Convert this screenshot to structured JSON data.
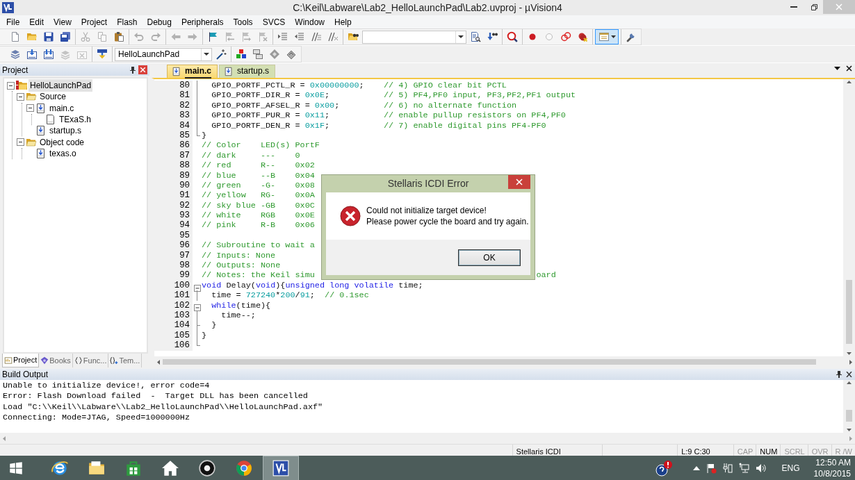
{
  "window": {
    "title": "C:\\Keil\\Labware\\Lab2_HelloLaunchPad\\Lab2.uvproj - µVision4"
  },
  "menu": [
    "File",
    "Edit",
    "View",
    "Project",
    "Flash",
    "Debug",
    "Peripherals",
    "Tools",
    "SVCS",
    "Window",
    "Help"
  ],
  "toolbar_1": [
    {
      "buttons": [
        {
          "kind": "new",
          "disabled": false,
          "pressed": false
        },
        {
          "kind": "open",
          "disabled": false,
          "pressed": false
        },
        {
          "kind": "save",
          "disabled": false,
          "pressed": false
        },
        {
          "kind": "save-all",
          "disabled": false,
          "pressed": false
        }
      ]
    },
    {
      "buttons": [
        {
          "kind": "cut",
          "disabled": true,
          "pressed": false
        },
        {
          "kind": "copy",
          "disabled": true,
          "pressed": false
        },
        {
          "kind": "paste",
          "disabled": false,
          "pressed": false
        }
      ]
    },
    {
      "buttons": [
        {
          "kind": "undo",
          "disabled": true,
          "pressed": false
        },
        {
          "kind": "redo",
          "disabled": true,
          "pressed": false
        }
      ]
    },
    {
      "buttons": [
        {
          "kind": "back",
          "disabled": true,
          "pressed": false
        },
        {
          "kind": "forward",
          "disabled": true,
          "pressed": false
        }
      ]
    },
    {
      "buttons": [
        {
          "kind": "bookmark",
          "disabled": false,
          "pressed": false
        },
        {
          "kind": "bookmark-prev",
          "disabled": true,
          "pressed": false
        },
        {
          "kind": "bookmark-next",
          "disabled": true,
          "pressed": false
        },
        {
          "kind": "bookmark-clear",
          "disabled": true,
          "pressed": false
        }
      ]
    },
    {
      "buttons": [
        {
          "kind": "indent",
          "disabled": false,
          "pressed": false
        },
        {
          "kind": "unindent",
          "disabled": false,
          "pressed": false
        },
        {
          "kind": "comment",
          "disabled": false,
          "pressed": false
        },
        {
          "kind": "uncomment",
          "disabled": false,
          "pressed": false
        }
      ]
    },
    {
      "buttons": [
        {
          "kind": "find-in-files",
          "disabled": false,
          "pressed": false
        },
        {
          "kind": "combo"
        },
        {
          "kind": "find",
          "disabled": false,
          "pressed": false
        },
        {
          "kind": "incremental-find",
          "disabled": false,
          "pressed": false
        }
      ]
    },
    {
      "buttons": [
        {
          "kind": "debug",
          "disabled": false,
          "pressed": false
        }
      ]
    },
    {
      "buttons": [
        {
          "kind": "breakpoint",
          "disabled": false,
          "pressed": false
        },
        {
          "kind": "breakpoint-enable",
          "disabled": true,
          "pressed": false
        },
        {
          "kind": "breakpoint-disable",
          "disabled": false,
          "pressed": false
        },
        {
          "kind": "breakpoint-kill",
          "disabled": false,
          "pressed": false
        }
      ]
    },
    {
      "buttons": [
        {
          "kind": "window",
          "disabled": false,
          "pressed": true
        }
      ]
    },
    {
      "buttons": [
        {
          "kind": "configure",
          "disabled": false,
          "pressed": false
        }
      ]
    }
  ],
  "toolbar_2": [
    {
      "buttons": [
        {
          "kind": "translate",
          "disabled": false,
          "pressed": false
        },
        {
          "kind": "build",
          "disabled": false,
          "pressed": false
        },
        {
          "kind": "rebuild",
          "disabled": false,
          "pressed": false
        },
        {
          "kind": "batch",
          "disabled": true,
          "pressed": false
        },
        {
          "kind": "stop",
          "disabled": true,
          "pressed": false
        }
      ]
    },
    {
      "buttons": [
        {
          "kind": "download",
          "disabled": false,
          "pressed": false
        }
      ]
    },
    {
      "buttons": [
        {
          "kind": "combo",
          "value": "HelloLaunchPad"
        },
        {
          "kind": "options",
          "disabled": false,
          "pressed": false
        }
      ]
    },
    {
      "buttons": [
        {
          "kind": "components",
          "disabled": false,
          "pressed": false
        },
        {
          "kind": "environment",
          "disabled": false,
          "pressed": false
        },
        {
          "kind": "books",
          "disabled": false,
          "pressed": false
        },
        {
          "kind": "packs",
          "disabled": false,
          "pressed": false
        }
      ]
    }
  ],
  "project_pane": {
    "title": "Project",
    "tree": [
      {
        "label": "HelloLaunchPad",
        "kind": "project",
        "expanded": true,
        "selected": true,
        "children": [
          {
            "label": "Source",
            "kind": "group",
            "expanded": true,
            "selected": false,
            "children": [
              {
                "label": "main.c",
                "kind": "source",
                "expanded": true,
                "selected": false,
                "children": [
                  {
                    "label": "TExaS.h",
                    "kind": "header",
                    "selected": false
                  }
                ]
              },
              {
                "label": "startup.s",
                "kind": "source",
                "selected": false
              }
            ]
          },
          {
            "label": "Object code",
            "kind": "group",
            "expanded": true,
            "selected": false,
            "children": [
              {
                "label": "texas.o",
                "kind": "source",
                "selected": false
              }
            ]
          }
        ]
      }
    ],
    "tabs": [
      {
        "label": "Project",
        "kind": "project",
        "selected": true
      },
      {
        "label": "Books",
        "kind": "books",
        "selected": false
      },
      {
        "label": "Func...",
        "kind": "functions",
        "selected": false
      },
      {
        "label": "Tem...",
        "kind": "templates",
        "selected": false
      }
    ]
  },
  "editor": {
    "tabs": [
      {
        "label": "main.c",
        "selected": true
      },
      {
        "label": "startup.s",
        "selected": false
      }
    ],
    "lines": [
      {
        "number": "80",
        "kind": "line",
        "segments": [
          {
            "kind": "plain",
            "text": "  GPIO_PORTF_PCTL_R = "
          },
          {
            "kind": "number",
            "text": "0x00000000"
          },
          {
            "kind": "plain",
            "text": ";    "
          },
          {
            "kind": "comment",
            "text": "// 4) GPIO clear bit PCTL"
          }
        ]
      },
      {
        "number": "81",
        "kind": "line",
        "segments": [
          {
            "kind": "plain",
            "text": "  GPIO_PORTF_DIR_R = "
          },
          {
            "kind": "number",
            "text": "0x0E"
          },
          {
            "kind": "plain",
            "text": ";           "
          },
          {
            "kind": "comment",
            "text": "// 5) PF4,PF0 input, PF3,PF2,PF1 output"
          }
        ]
      },
      {
        "number": "82",
        "kind": "line",
        "segments": [
          {
            "kind": "plain",
            "text": "  GPIO_PORTF_AFSEL_R = "
          },
          {
            "kind": "number",
            "text": "0x00"
          },
          {
            "kind": "plain",
            "text": ";         "
          },
          {
            "kind": "comment",
            "text": "// 6) no alternate function"
          }
        ]
      },
      {
        "number": "83",
        "kind": "line",
        "segments": [
          {
            "kind": "plain",
            "text": "  GPIO_PORTF_PUR_R = "
          },
          {
            "kind": "number",
            "text": "0x11"
          },
          {
            "kind": "plain",
            "text": ";           "
          },
          {
            "kind": "comment",
            "text": "// enable pullup resistors on PF4,PF0"
          }
        ]
      },
      {
        "number": "84",
        "kind": "line",
        "segments": [
          {
            "kind": "plain",
            "text": "  GPIO_PORTF_DEN_R = "
          },
          {
            "kind": "number",
            "text": "0x1F"
          },
          {
            "kind": "plain",
            "text": ";           "
          },
          {
            "kind": "comment",
            "text": "// 7) enable digital pins PF4-PF0"
          }
        ]
      },
      {
        "number": "85",
        "kind": "end",
        "segments": [
          {
            "kind": "plain",
            "text": "}"
          }
        ]
      },
      {
        "number": "86",
        "segments": [
          {
            "kind": "comment",
            "text": "// Color    LED(s) PortF"
          }
        ]
      },
      {
        "number": "87",
        "segments": [
          {
            "kind": "comment",
            "text": "// dark     ---    0"
          }
        ]
      },
      {
        "number": "88",
        "segments": [
          {
            "kind": "comment",
            "text": "// red      R--    0x02"
          }
        ]
      },
      {
        "number": "89",
        "segments": [
          {
            "kind": "comment",
            "text": "// blue     --B    0x04"
          }
        ]
      },
      {
        "number": "90",
        "segments": [
          {
            "kind": "comment",
            "text": "// green    -G-    0x08"
          }
        ]
      },
      {
        "number": "91",
        "segments": [
          {
            "kind": "comment",
            "text": "// yellow   RG-    0x0A"
          }
        ]
      },
      {
        "number": "92",
        "segments": [
          {
            "kind": "comment",
            "text": "// sky blue -GB    0x0C"
          }
        ]
      },
      {
        "number": "93",
        "segments": [
          {
            "kind": "comment",
            "text": "// white    RGB    0x0E"
          }
        ]
      },
      {
        "number": "94",
        "segments": [
          {
            "kind": "comment",
            "text": "// pink     R-B    0x06"
          }
        ]
      },
      {
        "number": "95"
      },
      {
        "number": "96",
        "segments": [
          {
            "kind": "comment",
            "text": "// Subroutine to wait a"
          }
        ]
      },
      {
        "number": "97",
        "segments": [
          {
            "kind": "comment",
            "text": "// Inputs: None"
          }
        ]
      },
      {
        "number": "98",
        "segments": [
          {
            "kind": "comment",
            "text": "// Outputs: None"
          }
        ]
      },
      {
        "number": "99",
        "segments": [
          {
            "kind": "comment",
            "text": "// Notes: the Keil simu"
          },
          {
            "kind": "comment",
            "text": "                                             oard"
          }
        ]
      },
      {
        "number": "100",
        "kind": "open",
        "segments": [
          {
            "kind": "keyword",
            "text": "void"
          },
          {
            "kind": "plain",
            "text": " Delay("
          },
          {
            "kind": "keyword",
            "text": "void"
          },
          {
            "kind": "plain",
            "text": "){"
          },
          {
            "kind": "keyword",
            "text": "unsigned long volatile"
          },
          {
            "kind": "plain",
            "text": " time;"
          }
        ]
      },
      {
        "number": "101",
        "kind": "line",
        "segments": [
          {
            "kind": "plain",
            "text": "  time = "
          },
          {
            "kind": "number",
            "text": "727240"
          },
          {
            "kind": "plain",
            "text": "*"
          },
          {
            "kind": "number",
            "text": "200"
          },
          {
            "kind": "plain",
            "text": "/"
          },
          {
            "kind": "number",
            "text": "91"
          },
          {
            "kind": "plain",
            "text": ";  "
          },
          {
            "kind": "comment",
            "text": "// 0.1sec"
          }
        ]
      },
      {
        "number": "102",
        "kind": "open",
        "segments": [
          {
            "kind": "keyword",
            "text": "  while"
          },
          {
            "kind": "plain",
            "text": "(time){"
          }
        ]
      },
      {
        "number": "103",
        "kind": "line",
        "segments": [
          {
            "kind": "plain",
            "text": "    time--;"
          }
        ]
      },
      {
        "number": "104",
        "kind": "tee",
        "segments": [
          {
            "kind": "plain",
            "text": "  }"
          }
        ]
      },
      {
        "number": "105",
        "kind": "line",
        "segments": [
          {
            "kind": "plain",
            "text": "}"
          }
        ]
      },
      {
        "number": "106",
        "kind": "end"
      }
    ]
  },
  "dialog": {
    "title": "Stellaris ICDI Error",
    "message_lines": [
      "Could not initialize target device!",
      "Please power cycle the board and try again."
    ],
    "buttons": [
      "OK"
    ]
  },
  "build_output": {
    "title": "Build Output",
    "lines": [
      "Unable to initialize device!, error code=4",
      "Error: Flash Download failed  -  Target DLL has been cancelled",
      "Load \"C:\\\\Keil\\\\Labware\\\\Lab2_HelloLaunchPad\\\\HelloLaunchPad.axf\"",
      "Connecting: Mode=JTAG, Speed=1000000Hz"
    ]
  },
  "status_bar": {
    "fields": [
      "Stellaris ICDI",
      "L:9 C:30"
    ],
    "indicators": [
      {
        "label": "CAP",
        "on": false
      },
      {
        "label": "NUM",
        "on": true
      },
      {
        "label": "SCRL",
        "on": false
      },
      {
        "label": "OVR",
        "on": false
      },
      {
        "label": "R /W",
        "on": false
      }
    ]
  },
  "taskbar": {
    "apps": [
      {
        "kind": "browser",
        "selected": false
      },
      {
        "kind": "files",
        "selected": false
      },
      {
        "kind": "store",
        "selected": false
      },
      {
        "kind": "home",
        "selected": false
      },
      {
        "kind": "camera",
        "selected": false
      },
      {
        "kind": "chrome",
        "selected": false
      },
      {
        "kind": "keil",
        "selected": true
      }
    ],
    "language": "ENG",
    "time": "12:50 AM",
    "date": "10/8/2015"
  }
}
